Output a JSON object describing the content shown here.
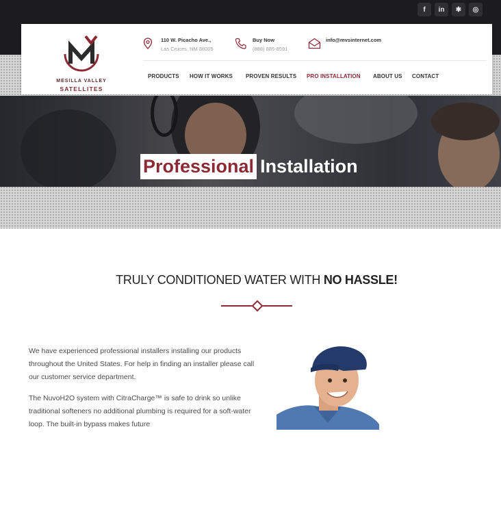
{
  "social": {
    "icons": [
      "facebook-icon",
      "linkedin-icon",
      "yelp-icon",
      "instagram-icon"
    ],
    "glyphs": [
      "f",
      "in",
      "✱",
      "◎"
    ]
  },
  "brand": {
    "line1": "MESILLA VALLEY",
    "line2": "SATELLITES"
  },
  "contact": {
    "address_line1": "110 W. Picacho Ave.,",
    "address_line2": "Las Cruces, NM 88005",
    "phone_label": "Buy Now",
    "phone_number": "(888) 885-8591",
    "email": "info@mvsinternet.com"
  },
  "nav": {
    "items": [
      {
        "label": "PRODUCTS"
      },
      {
        "label": "HOW IT WORKS"
      },
      {
        "label": "PROVEN RESULTS"
      },
      {
        "label": "PRO INSTALLATION"
      },
      {
        "label": "ABOUT US"
      },
      {
        "label": "CONTACT"
      }
    ],
    "active": "PRO INSTALLATION"
  },
  "hero": {
    "highlight": "Professional",
    "rest": "Installation"
  },
  "section": {
    "heading_light": "TRULY CONDITIONED WATER WITH ",
    "heading_bold": "NO HASSLE!"
  },
  "content": {
    "para1": "We have experienced professional installers installing our products throughout the United States. For help in finding an installer please call our customer service department.",
    "para2": "The NuvoH2O system with CitraCharge™ is safe to drink so unlike traditional softeners no additional plumbing is required for a soft-water loop.  The built-in bypass makes future"
  },
  "colors": {
    "accent": "#8b2a35",
    "topbar": "#1c1c1e"
  }
}
